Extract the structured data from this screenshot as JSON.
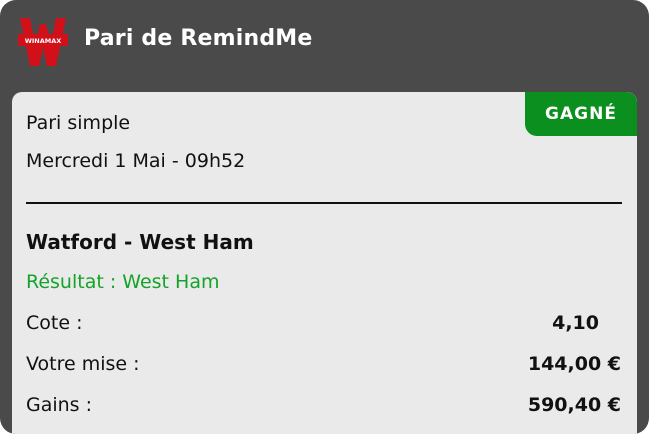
{
  "header": {
    "logo_text": "WINAMAX",
    "title": "Pari de RemindMe"
  },
  "bet": {
    "status": "GAGNÉ",
    "type": "Pari simple",
    "date": "Mercredi  1 Mai - 09h52",
    "match": "Watford - West Ham",
    "result": "Résultat : West Ham",
    "odds_label": "Cote :",
    "odds_value": "4,10",
    "stake_label": "Votre mise :",
    "stake_value": "144,00 €",
    "winnings_label": "Gains :",
    "winnings_value": "590,40 €"
  },
  "colors": {
    "header_bg": "#4a4a4a",
    "card_bg": "#eaeaea",
    "status_green": "#0b8f1e",
    "result_green": "#13a32a",
    "logo_red": "#d2101a"
  },
  "icons": {
    "logo": "winamax-logo-icon"
  }
}
